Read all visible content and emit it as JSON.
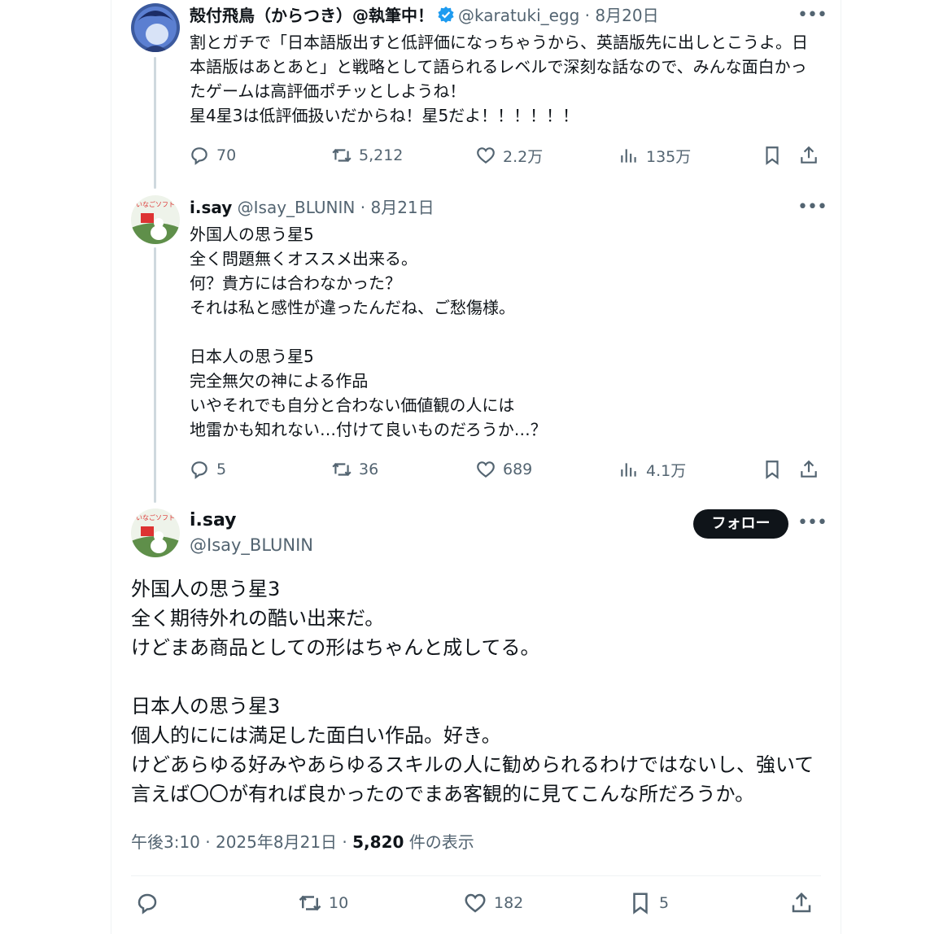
{
  "tweet1": {
    "author_name": "殻付飛鳥（からつき）@執筆中！",
    "handle": "@karatuki_egg",
    "date": "8月20日",
    "text": "割とガチで「日本語版出すと低評価になっちゃうから、英語版先に出しとこうよ。日本語版はあとあと」と戦略として語られるレベルで深刻な話なので、みんな面白かったゲームは高評価ポチッとしようね！\n星4星3は低評価扱いだからね！星5だよ！！！！！！",
    "stats": {
      "replies": "70",
      "retweets": "5,212",
      "likes": "2.2万",
      "views": "135万"
    }
  },
  "tweet2": {
    "author_name": "i.say",
    "handle": "@Isay_BLUNIN",
    "date": "8月21日",
    "text": "外国人の思う星5\n全く問題無くオススメ出来る。\n何？貴方には合わなかった？\nそれは私と感性が違ったんだね、ご愁傷様。\n\n日本人の思う星5\n完全無欠の神による作品\nいやそれでも自分と合わない価値観の人には\n地雷かも知れない…付けて良いものだろうか…？",
    "stats": {
      "replies": "5",
      "retweets": "36",
      "likes": "689",
      "views": "4.1万"
    }
  },
  "main_tweet": {
    "author_name": "i.say",
    "handle": "@Isay_BLUNIN",
    "follow_label": "フォロー",
    "text": "外国人の思う星3\n全く期待外れの酷い出来だ。\nけどまあ商品としての形はちゃんと成してる。\n\n日本人の思う星3\n個人的にには満足した面白い作品。好き。\nけどあらゆる好みやあらゆるスキルの人に勧められるわけではないし、強いて言えば〇〇が有れば良かったのでまあ客観的に見てこんな所だろうか。",
    "timestamp": "午後3:10 · 2025年8月21日 · ",
    "view_count": "5,820",
    "view_label": " 件の表示",
    "stats": {
      "retweets": "10",
      "likes": "182",
      "bookmarks": "5"
    }
  },
  "avatar_text": "いなごソフト",
  "colors": {
    "accent": "#1d9bf0",
    "text": "#0f1419",
    "muted": "#536471",
    "line": "#cfd9de"
  }
}
